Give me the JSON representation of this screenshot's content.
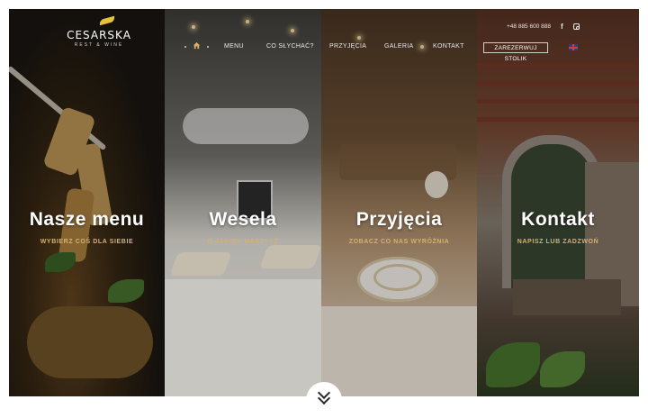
{
  "brand": {
    "name": "CESARSKA",
    "tagline": "REST & WINE"
  },
  "header": {
    "phone": "+48 885 600 888",
    "reserve_label": "ZAREZERWUJ STOLIK",
    "nav": [
      "MENU",
      "CO SŁYCHAĆ?",
      "PRZYJĘCIA",
      "GALERIA",
      "KONTAKT"
    ]
  },
  "panels": [
    {
      "title": "Nasze menu",
      "subtitle": "WYBIERZ COŚ DLA SIEBIE"
    },
    {
      "title": "Wesela",
      "subtitle": "O JAKICH MARZYSZ"
    },
    {
      "title": "Przyjęcia",
      "subtitle": "ZOBACZ CO NAS WYRÓŻNIA"
    },
    {
      "title": "Kontakt",
      "subtitle": "NAPISZ LUB ZADZWOŃ"
    }
  ],
  "colors": {
    "accent": "#d6b16a",
    "logo_leaf": "#e4c23a"
  },
  "icons": [
    "home-icon",
    "facebook-icon",
    "instagram-icon",
    "uk-flag-icon",
    "scroll-down-icon"
  ]
}
